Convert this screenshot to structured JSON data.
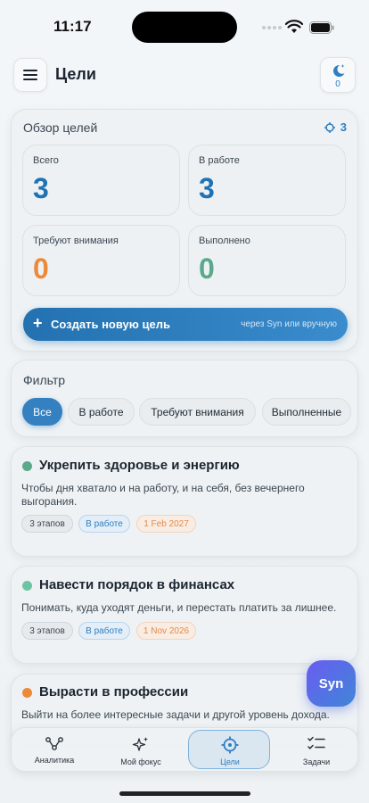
{
  "status_bar": {
    "time": "11:17"
  },
  "header": {
    "title": "Цели",
    "focus_count": "0"
  },
  "overview": {
    "title": "Обзор целей",
    "count": "3",
    "stats": [
      {
        "label": "Всего",
        "value": "3",
        "color": "#1f72b3"
      },
      {
        "label": "В работе",
        "value": "3",
        "color": "#1f72b3"
      },
      {
        "label": "Требуют внимания",
        "value": "0",
        "color": "#ec8a3a"
      },
      {
        "label": "Выполнено",
        "value": "0",
        "color": "#5aa98a"
      }
    ],
    "create_button": {
      "plus": "+",
      "label": "Создать новую цель",
      "hint": "через Syn или вручную"
    }
  },
  "filter": {
    "title": "Фильтр",
    "chips": [
      "Все",
      "В работе",
      "Требуют внимания",
      "Выполненные"
    ],
    "selected": "Все"
  },
  "goals": [
    {
      "title": "Укрепить здоровье и энергию",
      "description": "Чтобы дня хватало и на работу, и на себя, без вечернего выгорания.",
      "dot_color": "#5aa98a",
      "stages": "3 этапов",
      "status": "В работе",
      "date": "1 Feb 2027"
    },
    {
      "title": "Навести порядок в финансах",
      "description": "Понимать, куда уходят деньги, и перестать платить за лишнее.",
      "dot_color": "#6cc4a4",
      "stages": "3 этапов",
      "status": "В работе",
      "date": "1 Nov 2026"
    },
    {
      "title": "Вырасти в профессии",
      "description": "Выйти на более интересные задачи и другой уровень дохода.",
      "dot_color": "#ec8a3a"
    }
  ],
  "fab": {
    "label": "Syn"
  },
  "bottom_nav": [
    {
      "label": "Аналитика",
      "icon": "analytics-icon"
    },
    {
      "label": "Мой фокус",
      "icon": "sparkles-icon"
    },
    {
      "label": "Цели",
      "icon": "target-icon",
      "active": true
    },
    {
      "label": "Задачи",
      "icon": "tasks-icon"
    }
  ],
  "colors": {
    "accent": "#2e7fc2",
    "brand_gradient_start": "#6a5cf0"
  }
}
